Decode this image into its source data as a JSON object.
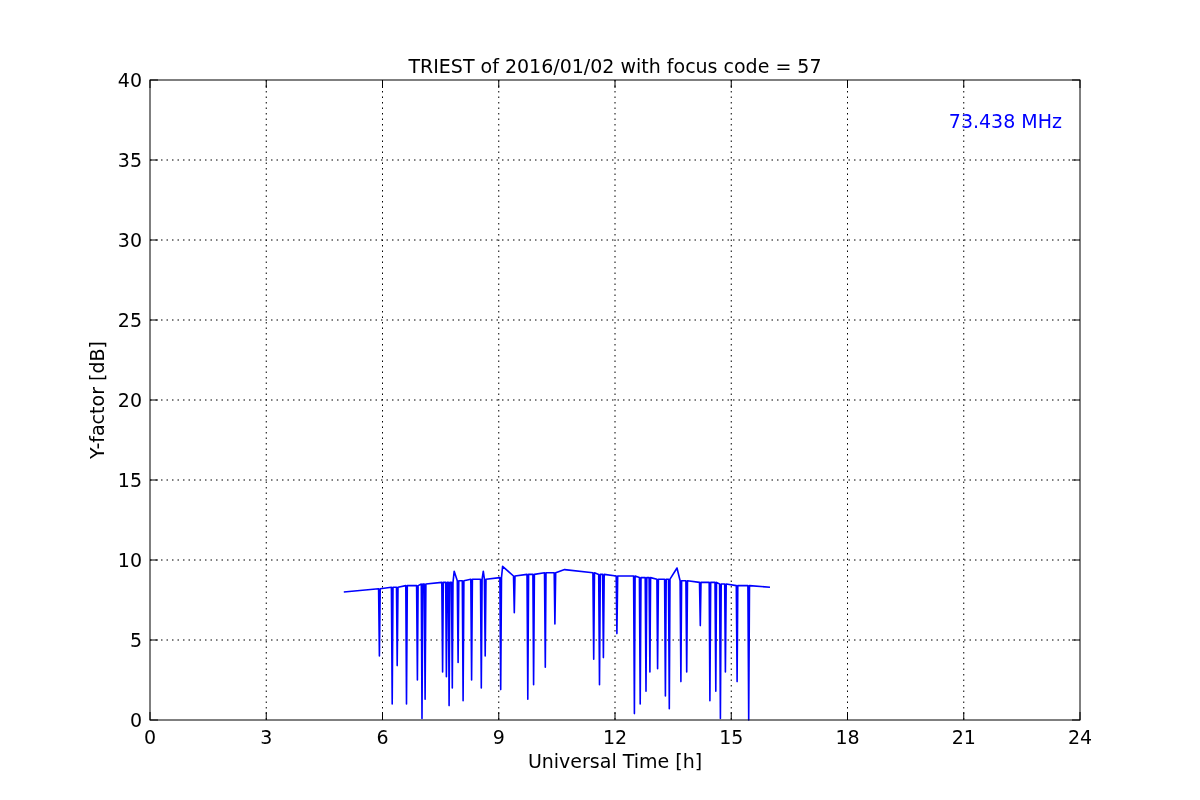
{
  "figure": {
    "chart_data": {
      "type": "line",
      "title": "TRIEST of 2016/01/02 with focus code = 57",
      "xlabel": "Universal Time [h]",
      "ylabel": "Y-factor [dB]",
      "xlim": [
        0,
        24
      ],
      "ylim": [
        0,
        40
      ],
      "xticks": [
        0,
        3,
        6,
        9,
        12,
        15,
        18,
        21,
        24
      ],
      "yticks": [
        0,
        5,
        10,
        15,
        20,
        25,
        30,
        35,
        40
      ],
      "x": [
        5.0,
        5.9,
        5.92,
        5.94,
        6.23,
        6.25,
        6.27,
        6.36,
        6.38,
        6.4,
        6.6,
        6.62,
        6.64,
        6.88,
        6.9,
        6.92,
        7.0,
        7.02,
        7.04,
        7.08,
        7.1,
        7.12,
        7.53,
        7.55,
        7.57,
        7.63,
        7.65,
        7.67,
        7.7,
        7.72,
        7.74,
        7.78,
        7.8,
        7.82,
        7.85,
        7.93,
        7.95,
        7.97,
        8.06,
        8.08,
        8.1,
        8.28,
        8.3,
        8.32,
        8.53,
        8.55,
        8.57,
        8.6,
        8.63,
        8.65,
        8.67,
        9.03,
        9.05,
        9.07,
        9.1,
        9.38,
        9.4,
        9.42,
        9.73,
        9.75,
        9.77,
        9.88,
        9.9,
        9.92,
        10.18,
        10.2,
        10.22,
        10.43,
        10.45,
        10.47,
        10.7,
        11.43,
        11.45,
        11.47,
        11.58,
        11.6,
        11.62,
        11.68,
        11.7,
        11.72,
        12.03,
        12.05,
        12.07,
        12.48,
        12.5,
        12.52,
        12.63,
        12.65,
        12.67,
        12.78,
        12.8,
        12.82,
        12.88,
        12.9,
        12.92,
        13.08,
        13.1,
        13.12,
        13.28,
        13.3,
        13.32,
        13.38,
        13.4,
        13.42,
        13.6,
        13.68,
        13.7,
        13.72,
        13.83,
        13.85,
        13.87,
        14.18,
        14.2,
        14.22,
        14.43,
        14.45,
        14.47,
        14.58,
        14.6,
        14.62,
        14.7,
        14.72,
        14.74,
        14.83,
        14.85,
        14.87,
        15.13,
        15.15,
        15.17,
        15.43,
        15.45,
        15.47,
        16.0
      ],
      "series": [
        {
          "name": "73.438 MHz",
          "color": "#0000ff",
          "values": [
            8.0,
            8.2,
            4.0,
            8.2,
            8.3,
            1.0,
            8.3,
            8.3,
            3.4,
            8.3,
            8.4,
            1.0,
            8.4,
            8.4,
            2.5,
            8.4,
            8.5,
            0.1,
            8.5,
            8.5,
            1.3,
            8.5,
            8.6,
            3.0,
            8.6,
            8.6,
            2.7,
            8.6,
            8.6,
            0.9,
            8.6,
            8.6,
            2.0,
            8.6,
            9.3,
            8.7,
            3.6,
            8.7,
            8.7,
            1.2,
            8.7,
            8.8,
            2.5,
            8.8,
            8.8,
            2.0,
            8.8,
            9.3,
            8.8,
            4.0,
            8.8,
            8.9,
            1.9,
            8.9,
            9.6,
            9.0,
            6.7,
            9.0,
            9.1,
            1.3,
            9.1,
            9.1,
            2.2,
            9.1,
            9.2,
            3.3,
            9.2,
            9.2,
            6.0,
            9.2,
            9.4,
            9.2,
            3.8,
            9.2,
            9.1,
            2.2,
            9.1,
            9.1,
            3.9,
            9.1,
            9.0,
            5.4,
            9.0,
            9.0,
            0.4,
            9.0,
            8.9,
            1.0,
            8.9,
            8.9,
            1.8,
            8.9,
            8.9,
            3.0,
            8.9,
            8.8,
            3.2,
            8.8,
            8.8,
            1.5,
            8.8,
            8.8,
            0.7,
            8.8,
            9.5,
            8.7,
            2.4,
            8.7,
            8.7,
            3.0,
            8.7,
            8.6,
            5.9,
            8.6,
            8.6,
            1.2,
            8.6,
            8.6,
            1.8,
            8.6,
            8.5,
            0.1,
            8.5,
            8.5,
            3.0,
            8.5,
            8.4,
            2.4,
            8.4,
            8.4,
            0.0,
            8.4,
            8.3
          ]
        }
      ],
      "grid": true
    }
  }
}
